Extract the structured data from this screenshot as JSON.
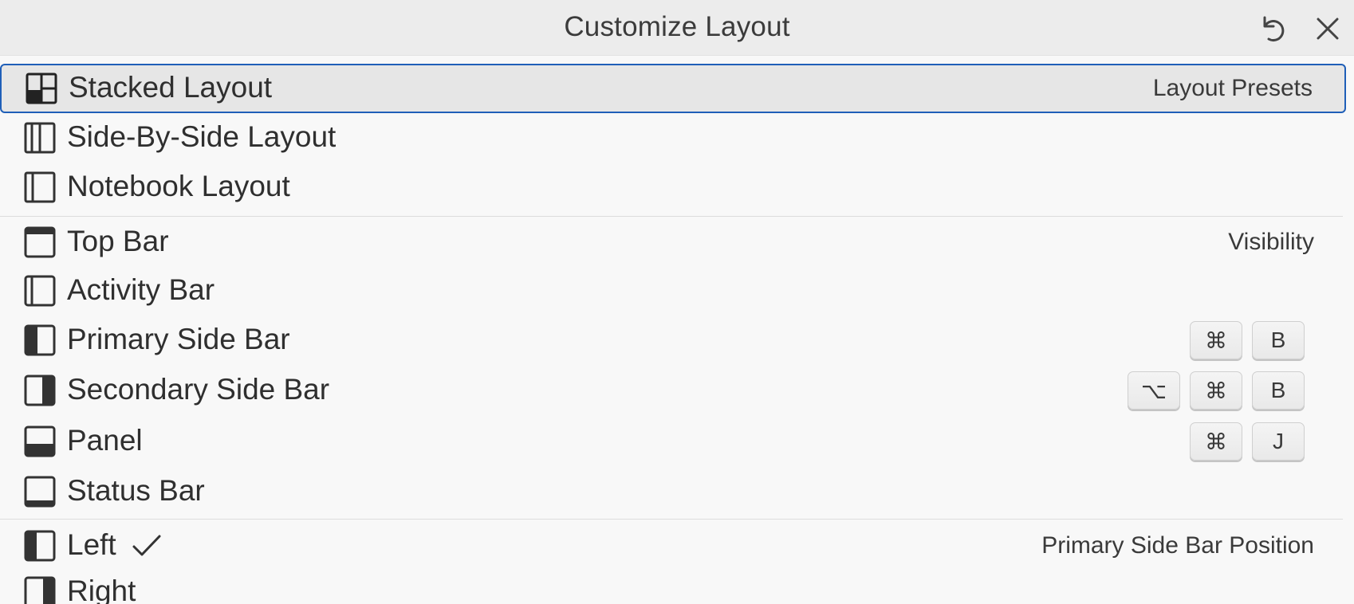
{
  "window": {
    "title": "Customize Layout",
    "reset_icon": "discard-icon",
    "close_icon": "close-icon"
  },
  "accent_color": "#1f5fb8",
  "groups": {
    "presets": {
      "header": "Layout Presets",
      "items": [
        {
          "label": "Stacked Layout",
          "icon": "stacked-layout-icon",
          "selected": true
        },
        {
          "label": "Side-By-Side Layout",
          "icon": "side-by-side-layout-icon"
        },
        {
          "label": "Notebook Layout",
          "icon": "notebook-layout-icon"
        }
      ]
    },
    "visibility": {
      "header": "Visibility",
      "items": [
        {
          "label": "Top Bar",
          "icon": "top-bar-icon"
        },
        {
          "label": "Activity Bar",
          "icon": "activity-bar-icon"
        },
        {
          "label": "Primary Side Bar",
          "icon": "primary-side-bar-icon",
          "keys": [
            "⌘",
            "B"
          ]
        },
        {
          "label": "Secondary Side Bar",
          "icon": "secondary-side-bar-icon",
          "keys": [
            "⌥",
            "⌘",
            "B"
          ]
        },
        {
          "label": "Panel",
          "icon": "panel-icon",
          "keys": [
            "⌘",
            "J"
          ]
        },
        {
          "label": "Status Bar",
          "icon": "status-bar-icon"
        }
      ]
    },
    "position": {
      "header": "Primary Side Bar Position",
      "items": [
        {
          "label": "Left",
          "icon": "side-bar-left-icon",
          "checked": true
        },
        {
          "label": "Right",
          "icon": "side-bar-right-icon"
        }
      ]
    }
  }
}
